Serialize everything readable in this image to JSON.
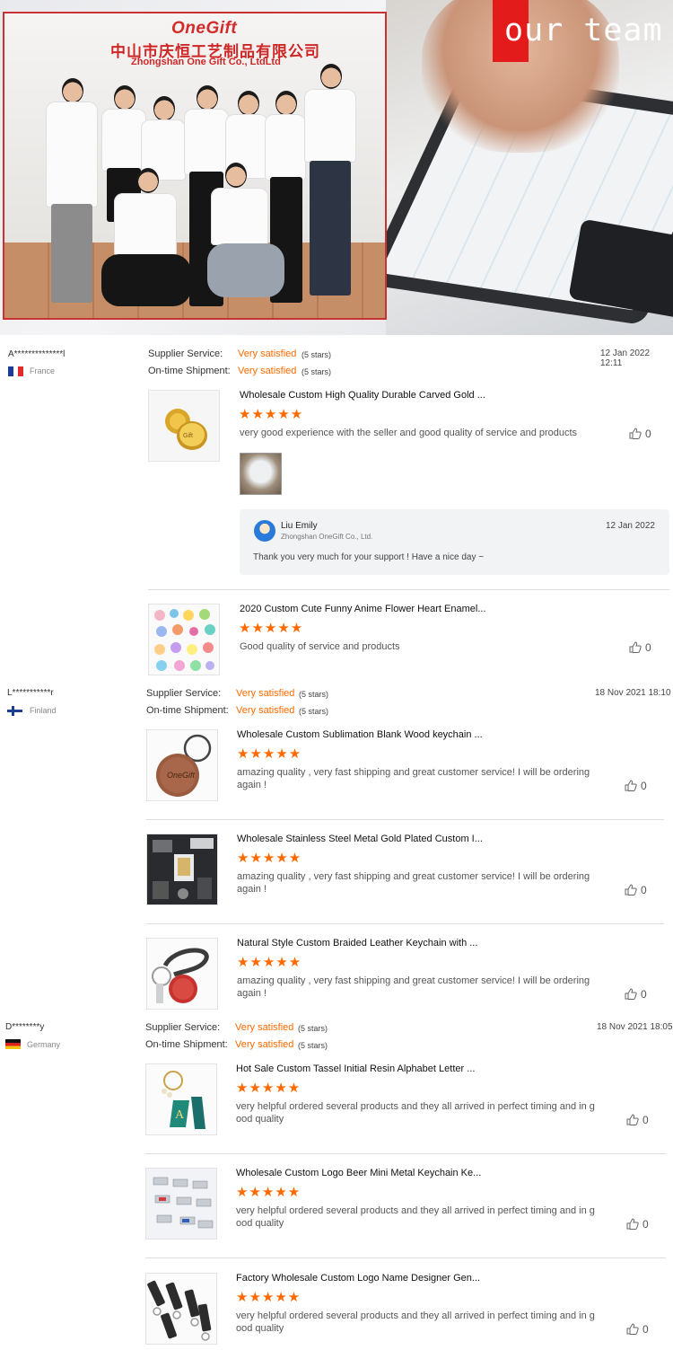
{
  "banner": {
    "logo": "OneGift",
    "chinese_name": "中山市庆恒工艺制品有限公司",
    "english_name": "Zhongshan One Gift Co., LtdLtd",
    "team_label": "our team",
    "accent_color": "#e31b1b"
  },
  "labels": {
    "supplier_service": "Supplier Service:",
    "ontime_shipment": "On-time Shipment:",
    "very_satisfied": "Very satisfied",
    "five_stars": "(5 stars)",
    "stars": "★★★★★"
  },
  "reviews": [
    {
      "user": "A**************l",
      "country": "France",
      "date": "12 Jan 2022 12:11",
      "products": [
        {
          "title": "Wholesale Custom High Quality Durable Carved Gold ...",
          "comment": "very good experience with the seller and good quality of service and products",
          "likes": "0",
          "reply": {
            "name": "Liu Emily",
            "company": "Zhongshan OneGift Co., Ltd.",
            "date": "12 Jan 2022",
            "text": "Thank you very much for your support ! Have a nice day ~"
          }
        },
        {
          "title": "2020 Custom Cute Funny Anime Flower Heart Enamel...",
          "comment": "Good quality of service and products",
          "likes": "0"
        }
      ]
    },
    {
      "user": "L***********r",
      "country": "Finland",
      "date": "18 Nov 2021 18:10",
      "products": [
        {
          "title": "Wholesale Custom Sublimation Blank Wood keychain ...",
          "comment_l1": "amazing quality , very fast shipping and great customer service! I will be ordering",
          "comment_l2": "again !",
          "likes": "0"
        },
        {
          "title": "Wholesale Stainless Steel Metal Gold Plated Custom I...",
          "comment_l1": "amazing quality , very fast shipping and great customer service! I will be ordering",
          "comment_l2": "again !",
          "likes": "0"
        },
        {
          "title": "Natural Style Custom Braided Leather Keychain with ...",
          "comment_l1": "amazing quality , very fast shipping and great customer service! I will be ordering",
          "comment_l2": "again !",
          "likes": "0"
        }
      ]
    },
    {
      "user": "D********y",
      "country": "Germany",
      "date": "18 Nov 2021 18:05",
      "products": [
        {
          "title": "Hot Sale Custom Tassel Initial Resin Alphabet Letter ...",
          "comment_l1": "very helpful ordered several products and they all arrived in perfect timing and in g",
          "comment_l2": "ood quality",
          "likes": "0"
        },
        {
          "title": "Wholesale Custom Logo Beer Mini Metal Keychain Ke...",
          "comment_l1": "very helpful ordered several products and they all arrived in perfect timing and in g",
          "comment_l2": "ood quality",
          "likes": "0"
        },
        {
          "title": "Factory Wholesale Custom Logo Name Designer Gen...",
          "comment_l1": "very helpful ordered several products and they all arrived in perfect timing and in g",
          "comment_l2": "ood quality",
          "likes": "0"
        }
      ]
    }
  ]
}
